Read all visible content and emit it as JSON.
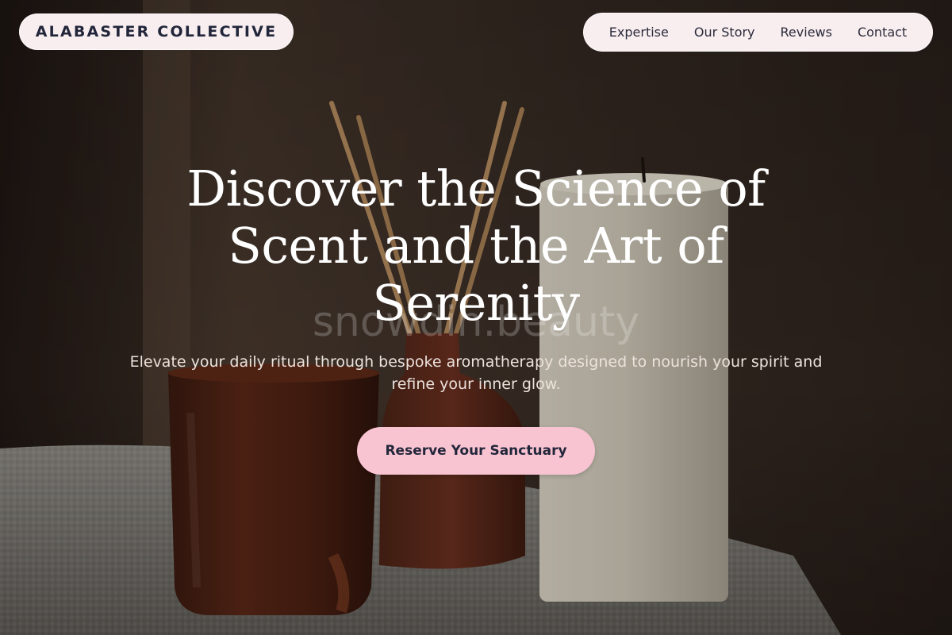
{
  "brand": {
    "name": "ALABASTER COLLECTIVE"
  },
  "nav": {
    "items": [
      {
        "label": "Expertise"
      },
      {
        "label": "Our Story"
      },
      {
        "label": "Reviews"
      },
      {
        "label": "Contact"
      }
    ]
  },
  "hero": {
    "title": "Discover the Science of Scent and the Art of Serenity",
    "subtitle": "Elevate your daily ritual through bespoke aromatherapy designed to nourish your spirit and refine your inner glow.",
    "cta_label": "Reserve Your Sanctuary",
    "watermark": "snowdin.beauty"
  },
  "colors": {
    "pill_background": "#f8eef0",
    "cta_background": "#f9c4d2",
    "text_dark": "#22263a",
    "hero_text": "#ffffff"
  }
}
